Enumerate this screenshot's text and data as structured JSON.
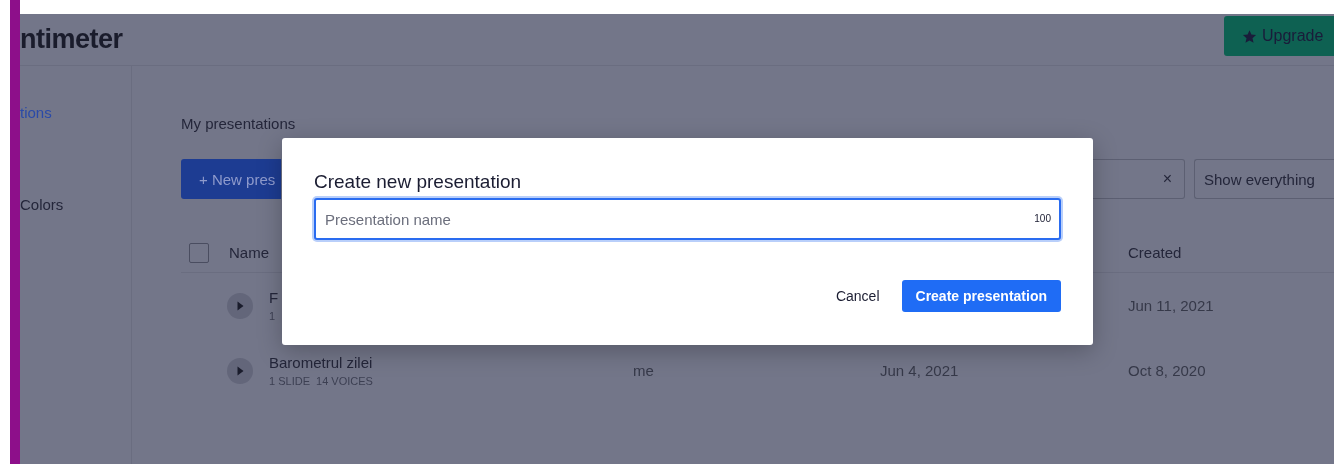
{
  "header": {
    "logo": "ntimeter",
    "upgrade_button": "Upgrade"
  },
  "sidebar": {
    "items": [
      {
        "label": "tions",
        "selected": true
      },
      {
        "label": "Colors",
        "selected": false
      }
    ]
  },
  "main": {
    "title": "My presentations",
    "new_button": "+ New pres",
    "search": {
      "clear": "×"
    },
    "filter": "Show everything"
  },
  "table": {
    "select_all": {
      "checked": false
    },
    "columns": [
      {
        "label": "Name"
      },
      {
        "label": "Created"
      }
    ],
    "rows": [
      {
        "name": "F",
        "meta": "1",
        "created": "Jun 11, 2021"
      },
      {
        "name": "Barometrul zilei",
        "meta": "1 SLIDE  14 VOICES",
        "owner": "me",
        "modified": "Jun 4, 2021",
        "created": "Oct 8, 2020"
      }
    ]
  },
  "dialog": {
    "title": "Create new presentation",
    "field": {
      "placeholder": "Presentation name",
      "counter": "100"
    },
    "buttons": [
      {
        "label": "Cancel",
        "kind": "secondary"
      },
      {
        "label": "Create presentation",
        "kind": "primary"
      }
    ]
  }
}
